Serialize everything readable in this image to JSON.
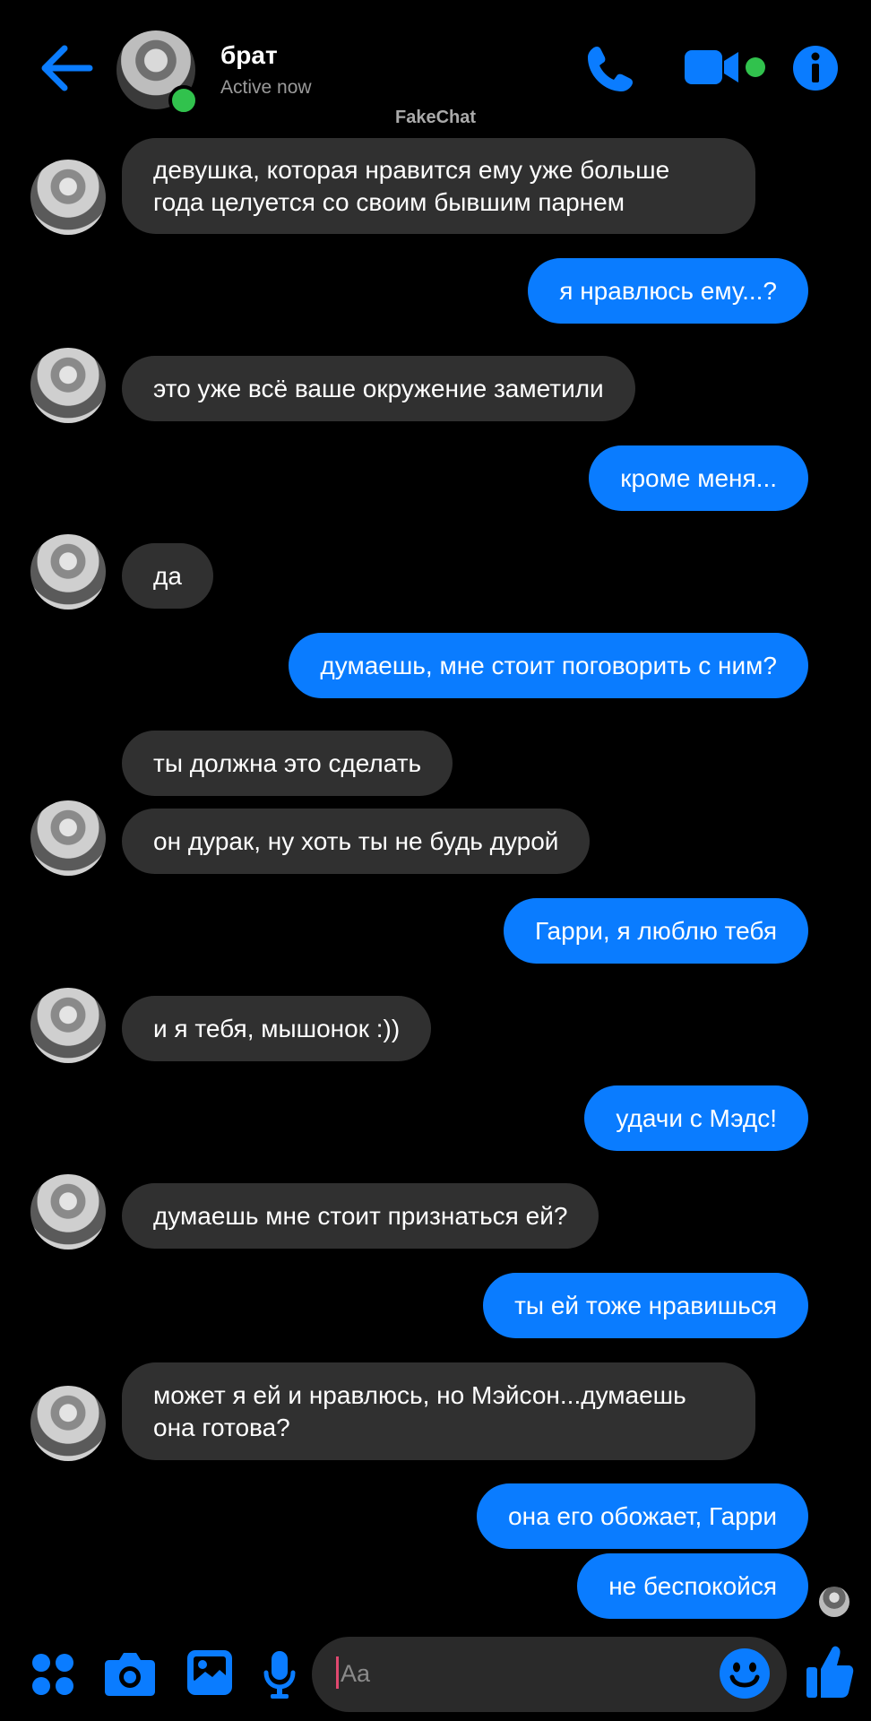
{
  "header": {
    "contact_name": "брат",
    "status": "Active now",
    "watermark": "FakeChat"
  },
  "icons": {
    "back": "arrow-left",
    "call": "phone",
    "video": "video-camera",
    "info": "info-circle",
    "apps": "four-dots",
    "camera": "camera",
    "gallery": "image",
    "mic": "microphone",
    "emoji": "smiley",
    "like": "thumbs-up"
  },
  "colors": {
    "accent": "#0a7cff",
    "incoming_bubble": "#303030",
    "online": "#31c24d",
    "background": "#000000"
  },
  "messages": [
    {
      "from": "contact",
      "text": "девушка, которая нравится ему уже больше года целуется со своим бывшим парнем"
    },
    {
      "from": "me",
      "text": "я нравлюсь ему...?"
    },
    {
      "from": "contact",
      "text": "это уже всё ваше окружение заметили"
    },
    {
      "from": "me",
      "text": "кроме меня..."
    },
    {
      "from": "contact",
      "text": "да"
    },
    {
      "from": "me",
      "text": "думаешь, мне стоит поговорить с ним?"
    },
    {
      "from": "contact",
      "text": "ты должна это сделать"
    },
    {
      "from": "contact",
      "text": "он дурак, ну хоть ты не будь дурой"
    },
    {
      "from": "me",
      "text": "Гарри, я люблю тебя"
    },
    {
      "from": "contact",
      "text": "и я тебя, мышонок :))"
    },
    {
      "from": "me",
      "text": "удачи с Мэдс!"
    },
    {
      "from": "contact",
      "text": "думаешь мне стоит признаться ей?"
    },
    {
      "from": "me",
      "text": "ты ей тоже нравишься"
    },
    {
      "from": "contact",
      "text": "может я ей и нравлюсь, но Мэйсон...думаешь она готова?"
    },
    {
      "from": "me",
      "text": "она его обожает, Гарри"
    },
    {
      "from": "me",
      "text": "не беспокойся"
    }
  ],
  "composer": {
    "placeholder": "Aa"
  }
}
